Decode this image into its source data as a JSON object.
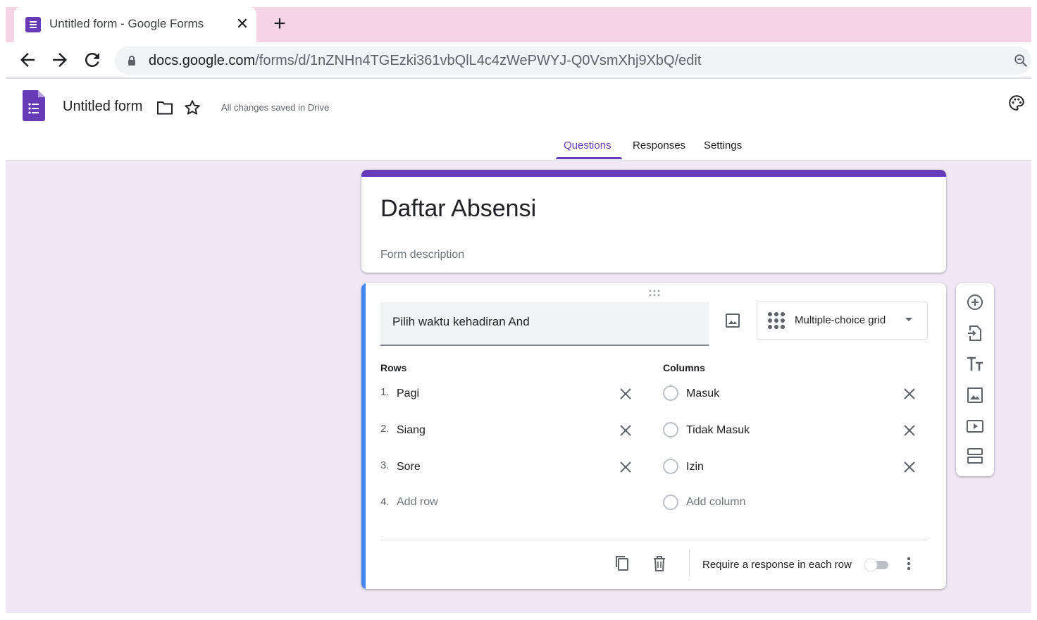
{
  "browser": {
    "tab_title": "Untitled form - Google Forms",
    "url_host": "docs.google.com",
    "url_path": "/forms/d/1nZNHn4TGEzki361vbQlL4c4zWePWYJ-Q0VsmXhj9XbQ/edit"
  },
  "header": {
    "form_name": "Untitled form",
    "save_status": "All changes saved in Drive",
    "tabs": [
      {
        "label": "Questions"
      },
      {
        "label": "Responses"
      },
      {
        "label": "Settings"
      }
    ],
    "accent_color": "#673ab7"
  },
  "title_card": {
    "title": "Daftar Absensi",
    "description_placeholder": "Form description"
  },
  "question": {
    "title": "Pilih waktu kehadiran And",
    "type": "Multiple-choice grid",
    "rows_label": "Rows",
    "columns_label": "Columns",
    "rows": [
      {
        "num": "1.",
        "label": "Pagi"
      },
      {
        "num": "2.",
        "label": "Siang"
      },
      {
        "num": "3.",
        "label": "Sore"
      }
    ],
    "add_row": {
      "num": "4.",
      "label": "Add row"
    },
    "columns": [
      {
        "label": "Masuk"
      },
      {
        "label": "Tidak Masuk"
      },
      {
        "label": "Izin"
      }
    ],
    "add_column": "Add column",
    "require_label": "Require a response in each row",
    "accent_color": "#4285f4"
  },
  "icons": {
    "tab_favicon": "google-forms-icon",
    "tab_close": "close-icon",
    "new_tab": "plus-icon",
    "back": "arrow-back-icon",
    "forward": "arrow-forward-icon",
    "reload": "reload-icon",
    "lock": "lock-icon",
    "zoom": "zoom-icon",
    "folder": "folder-icon",
    "star": "star-icon",
    "palette": "palette-icon",
    "image": "image-icon",
    "grid": "grid-icon",
    "copy": "copy-icon",
    "delete": "trash-icon",
    "more": "more-vert-icon",
    "toolbar": [
      "add-circle-icon",
      "import-question-icon",
      "title-text-icon",
      "add-image-icon",
      "add-video-icon",
      "add-section-icon"
    ]
  }
}
